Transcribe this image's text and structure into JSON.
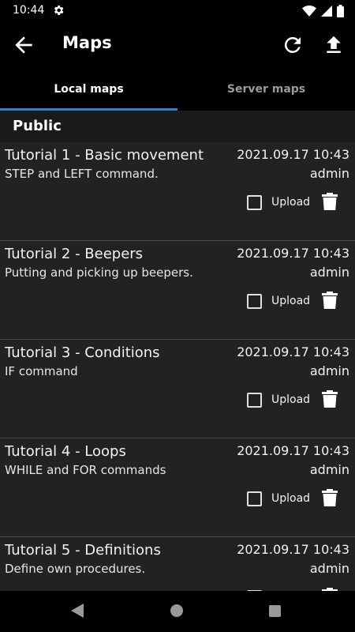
{
  "status_bar": {
    "time": "10:44"
  },
  "app_bar": {
    "title": "Maps"
  },
  "tabs": [
    {
      "label": "Local maps",
      "selected": true
    },
    {
      "label": "Server maps",
      "selected": false
    }
  ],
  "accent_color": "#2b82d9",
  "section": {
    "title": "Public"
  },
  "upload_label": "Upload",
  "maps": [
    {
      "title": "Tutorial 1 - Basic movement",
      "description": "STEP and LEFT command.",
      "date": "2021.09.17 10:43",
      "author": "admin"
    },
    {
      "title": "Tutorial 2 - Beepers",
      "description": "Putting and picking up beepers.",
      "date": "2021.09.17 10:43",
      "author": "admin"
    },
    {
      "title": "Tutorial 3 - Conditions",
      "description": "IF command",
      "date": "2021.09.17 10:43",
      "author": "admin"
    },
    {
      "title": "Tutorial 4 - Loops",
      "description": "WHILE and FOR commands",
      "date": "2021.09.17 10:43",
      "author": "admin"
    },
    {
      "title": "Tutorial 5 - Definitions",
      "description": "Define own procedures.",
      "date": "2021.09.17 10:43",
      "author": "admin"
    }
  ]
}
